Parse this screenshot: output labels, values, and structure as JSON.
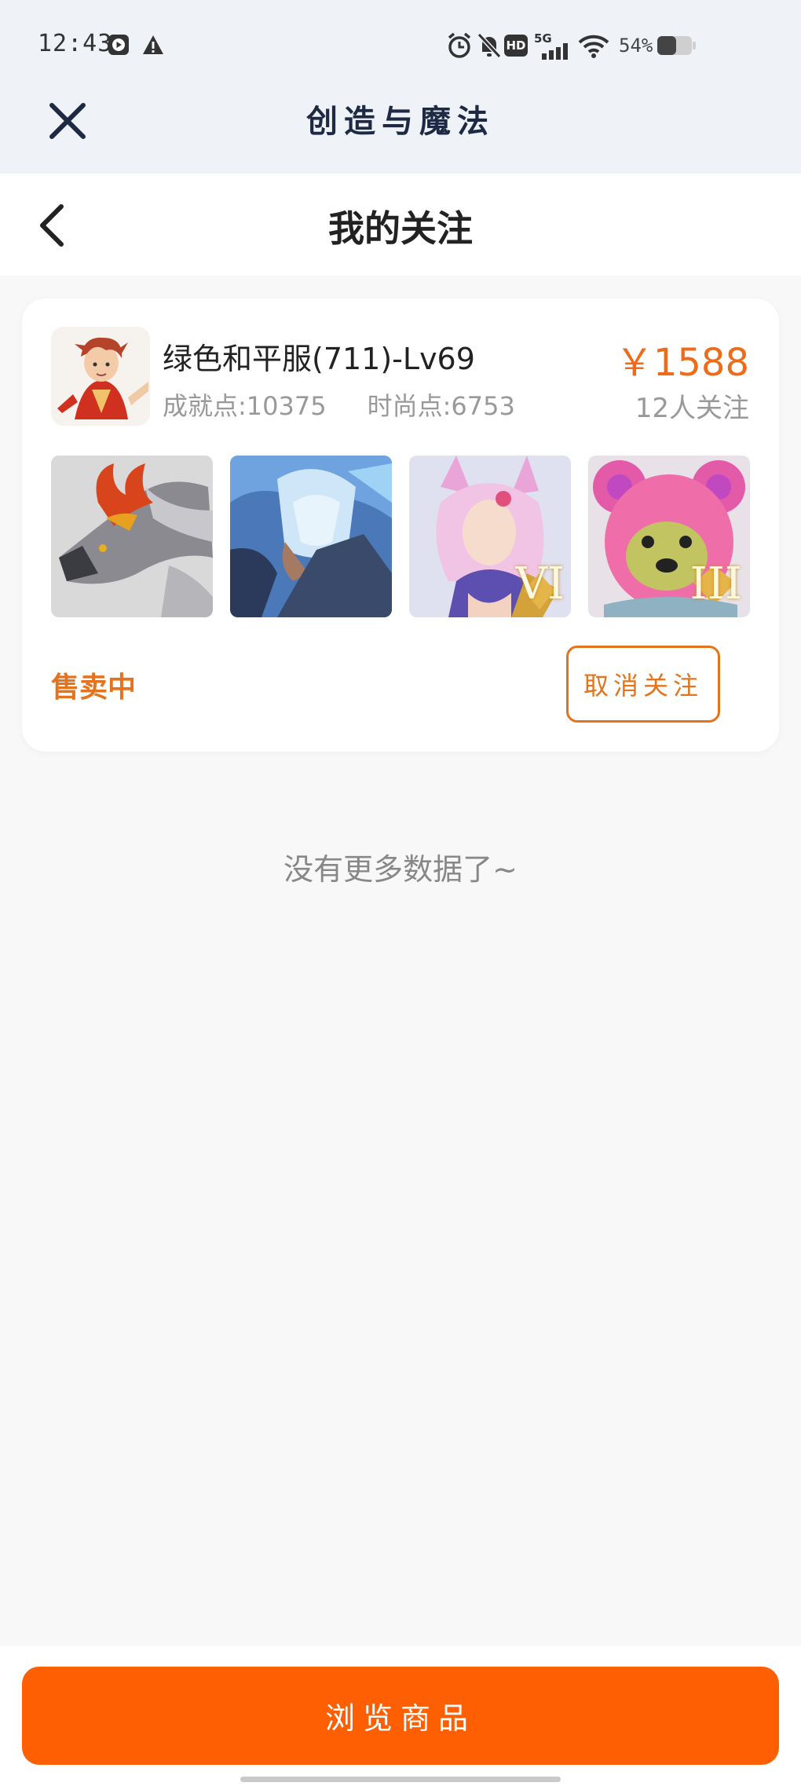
{
  "status_bar": {
    "time": "12:43",
    "network": "5G",
    "hd_badge": "HD",
    "battery": "54%",
    "icons": [
      "play-icon",
      "warning-icon",
      "alarm-icon",
      "mute-icon",
      "hd-icon",
      "signal-icon",
      "wifi-icon",
      "battery-icon"
    ]
  },
  "app_header": {
    "title": "创造与魔法",
    "close_icon": "close-icon"
  },
  "page_header": {
    "title": "我的关注",
    "back_icon": "chevron-left-icon"
  },
  "card": {
    "name": "绿色和平服(711)-Lv69",
    "achievement": "成就点:10375",
    "fashion": "时尚点:6753",
    "price": "￥1588",
    "followers": "12人关注",
    "thumbnails": [
      {
        "name": "dragon-mount",
        "badge": ""
      },
      {
        "name": "ice-armor",
        "badge": ""
      },
      {
        "name": "fox-fairy",
        "badge": "VI"
      },
      {
        "name": "pink-bear",
        "badge": "III"
      }
    ],
    "status": "售卖中",
    "unfollow_label": "取消关注"
  },
  "empty_hint": "没有更多数据了~",
  "browse_button": "浏览商品",
  "colors": {
    "accent": "#ee6b19",
    "button": "#fe5f03",
    "header_bg": "#eff3f7",
    "page_bg": "#f8f8f9"
  }
}
